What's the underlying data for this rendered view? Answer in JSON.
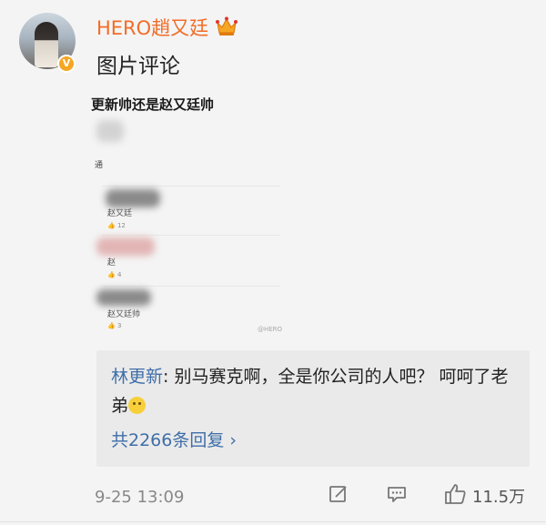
{
  "author": {
    "name": "HERO趙又廷",
    "verified_badge": "V",
    "crown_color": "#f5a623"
  },
  "comment": {
    "text": "图片评论"
  },
  "screenshot": {
    "title": "更新帅还是赵又廷帅",
    "stray_char": "通",
    "items": [
      {
        "name": "赵又廷",
        "likes": "12"
      },
      {
        "name": "赵",
        "likes": "4"
      },
      {
        "name": "赵又廷帅",
        "likes": "3"
      }
    ],
    "watermark": "@HERO"
  },
  "reply": {
    "author": "林更新",
    "separator": ": ",
    "text": "别马赛克啊，全是你公司的人吧？ 呵呵了老弟",
    "emoji": "smile-emoji",
    "count_label": "共2266条回复",
    "chevron": "›"
  },
  "footer": {
    "time": "9-25 13:09",
    "likes": "11.5万"
  },
  "colors": {
    "username": "#f26d28",
    "link": "#3f6ea8",
    "background": "#f4f4f4",
    "reply_bg": "#eaeaea"
  }
}
